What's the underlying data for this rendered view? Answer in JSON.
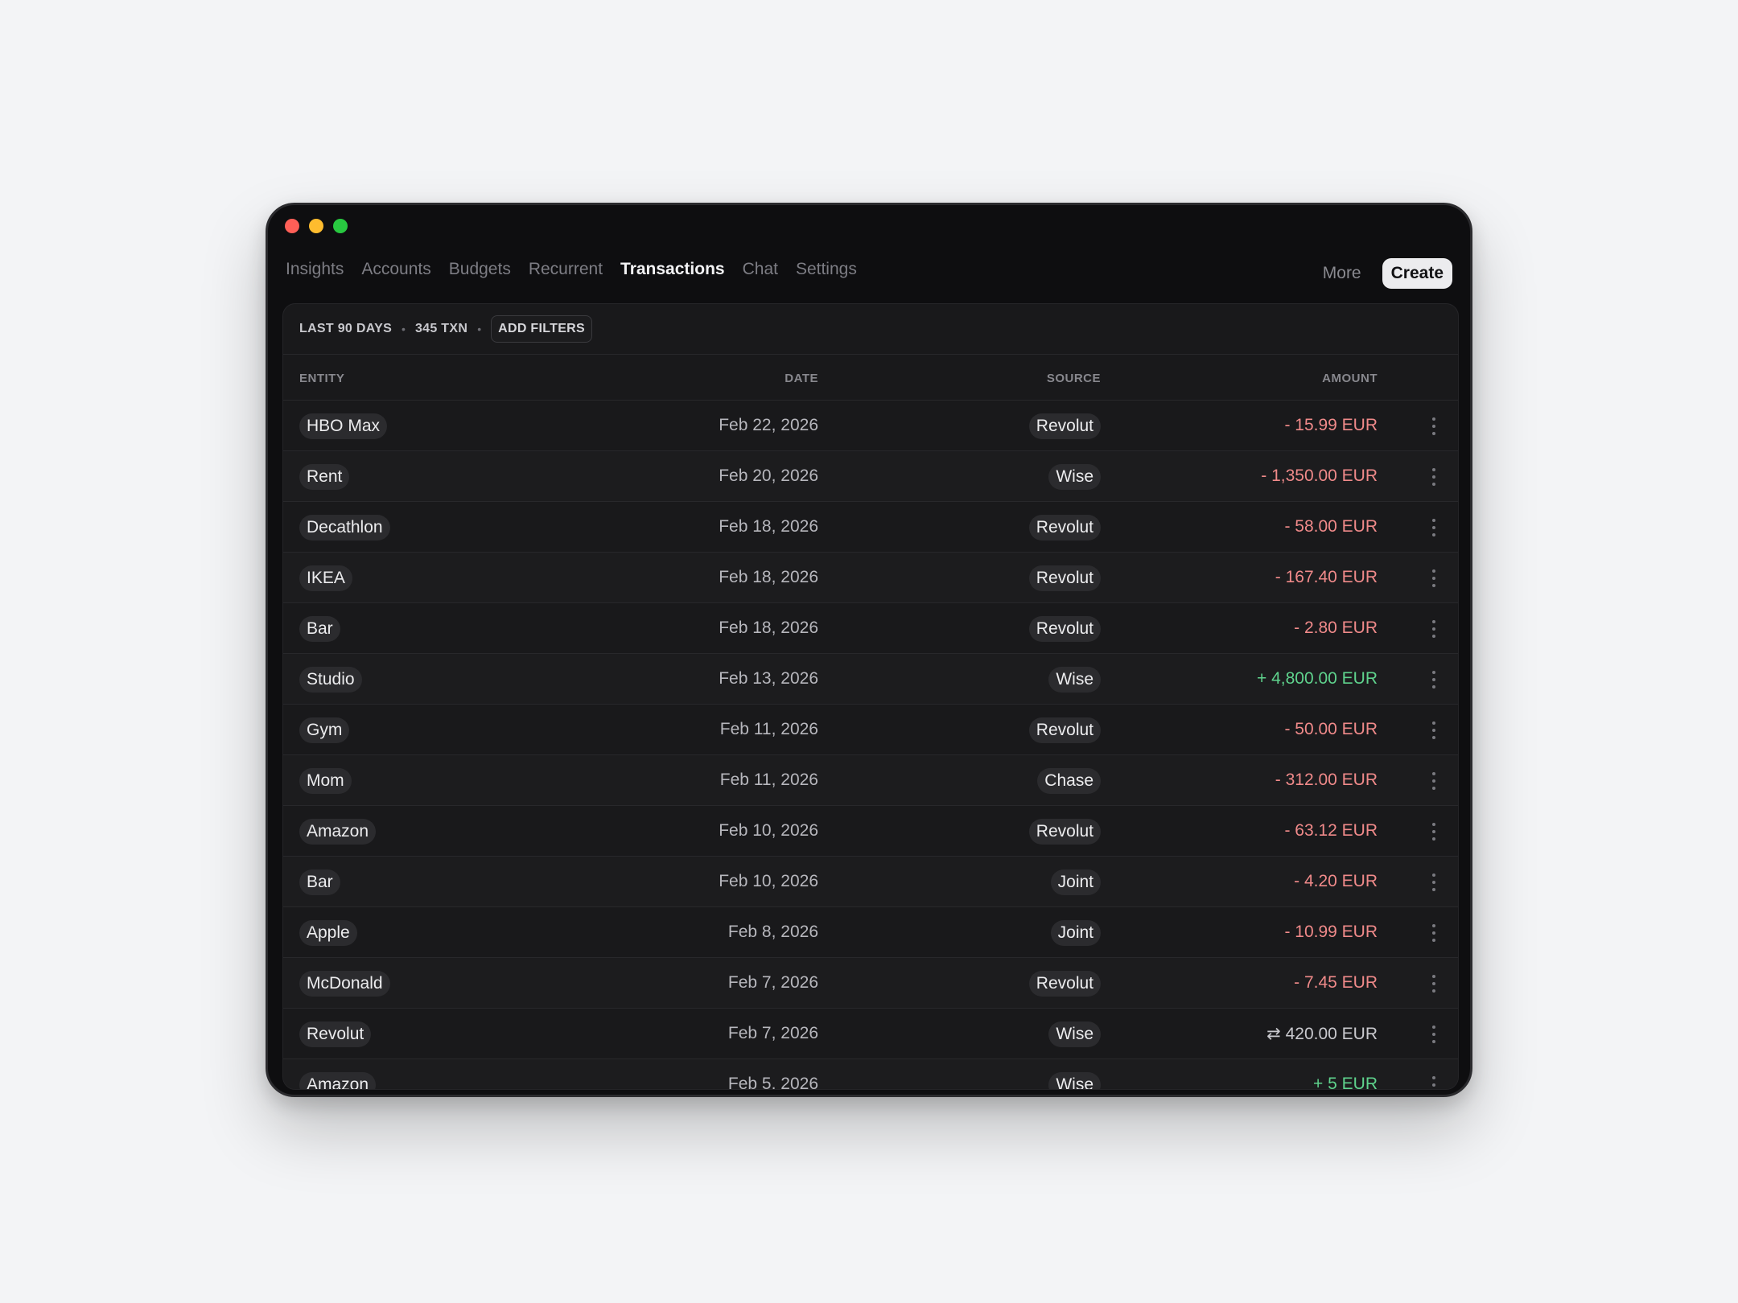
{
  "colors": {
    "negative": "#f08a8a",
    "positive": "#5fd38d",
    "transfer": "#c9c9ce",
    "light_red": "#fe5f57",
    "light_yellow": "#febc2e",
    "light_green": "#28c840"
  },
  "nav": {
    "items": [
      "Insights",
      "Accounts",
      "Budgets",
      "Recurrent",
      "Transactions",
      "Chat",
      "Settings"
    ],
    "active": "Transactions",
    "more": "More",
    "create": "Create"
  },
  "filters": {
    "period": "LAST 90 DAYS",
    "count": "345 TXN",
    "add": "ADD FILTERS",
    "separator": "•"
  },
  "table": {
    "headers": {
      "entity": "ENTITY",
      "date": "DATE",
      "source": "SOURCE",
      "amount": "AMOUNT"
    },
    "rows": [
      {
        "entity": "HBO Max",
        "date": "Feb 22, 2026",
        "source": "Revolut",
        "amount": "- 15.99 EUR",
        "kind": "negative"
      },
      {
        "entity": "Rent",
        "date": "Feb 20, 2026",
        "source": "Wise",
        "amount": "- 1,350.00 EUR",
        "kind": "negative"
      },
      {
        "entity": "Decathlon",
        "date": "Feb 18, 2026",
        "source": "Revolut",
        "amount": "- 58.00 EUR",
        "kind": "negative"
      },
      {
        "entity": "IKEA",
        "date": "Feb 18, 2026",
        "source": "Revolut",
        "amount": "- 167.40 EUR",
        "kind": "negative"
      },
      {
        "entity": "Bar",
        "date": "Feb 18, 2026",
        "source": "Revolut",
        "amount": "- 2.80 EUR",
        "kind": "negative"
      },
      {
        "entity": "Studio",
        "date": "Feb 13, 2026",
        "source": "Wise",
        "amount": "+ 4,800.00 EUR",
        "kind": "positive"
      },
      {
        "entity": "Gym",
        "date": "Feb 11, 2026",
        "source": "Revolut",
        "amount": "- 50.00 EUR",
        "kind": "negative"
      },
      {
        "entity": "Mom",
        "date": "Feb 11, 2026",
        "source": "Chase",
        "amount": "- 312.00 EUR",
        "kind": "negative"
      },
      {
        "entity": "Amazon",
        "date": "Feb 10, 2026",
        "source": "Revolut",
        "amount": "- 63.12 EUR",
        "kind": "negative"
      },
      {
        "entity": "Bar",
        "date": "Feb 10, 2026",
        "source": "Joint",
        "amount": "- 4.20 EUR",
        "kind": "negative"
      },
      {
        "entity": "Apple",
        "date": "Feb 8, 2026",
        "source": "Joint",
        "amount": "- 10.99 EUR",
        "kind": "negative"
      },
      {
        "entity": "McDonald",
        "date": "Feb 7, 2026",
        "source": "Revolut",
        "amount": "- 7.45 EUR",
        "kind": "negative"
      },
      {
        "entity": "Revolut",
        "date": "Feb 7, 2026",
        "source": "Wise",
        "amount": "⇄  420.00 EUR",
        "kind": "transfer"
      },
      {
        "entity": "Amazon",
        "date": "Feb 5, 2026",
        "source": "Wise",
        "amount": "+ 5 EUR",
        "kind": "positive"
      }
    ]
  }
}
